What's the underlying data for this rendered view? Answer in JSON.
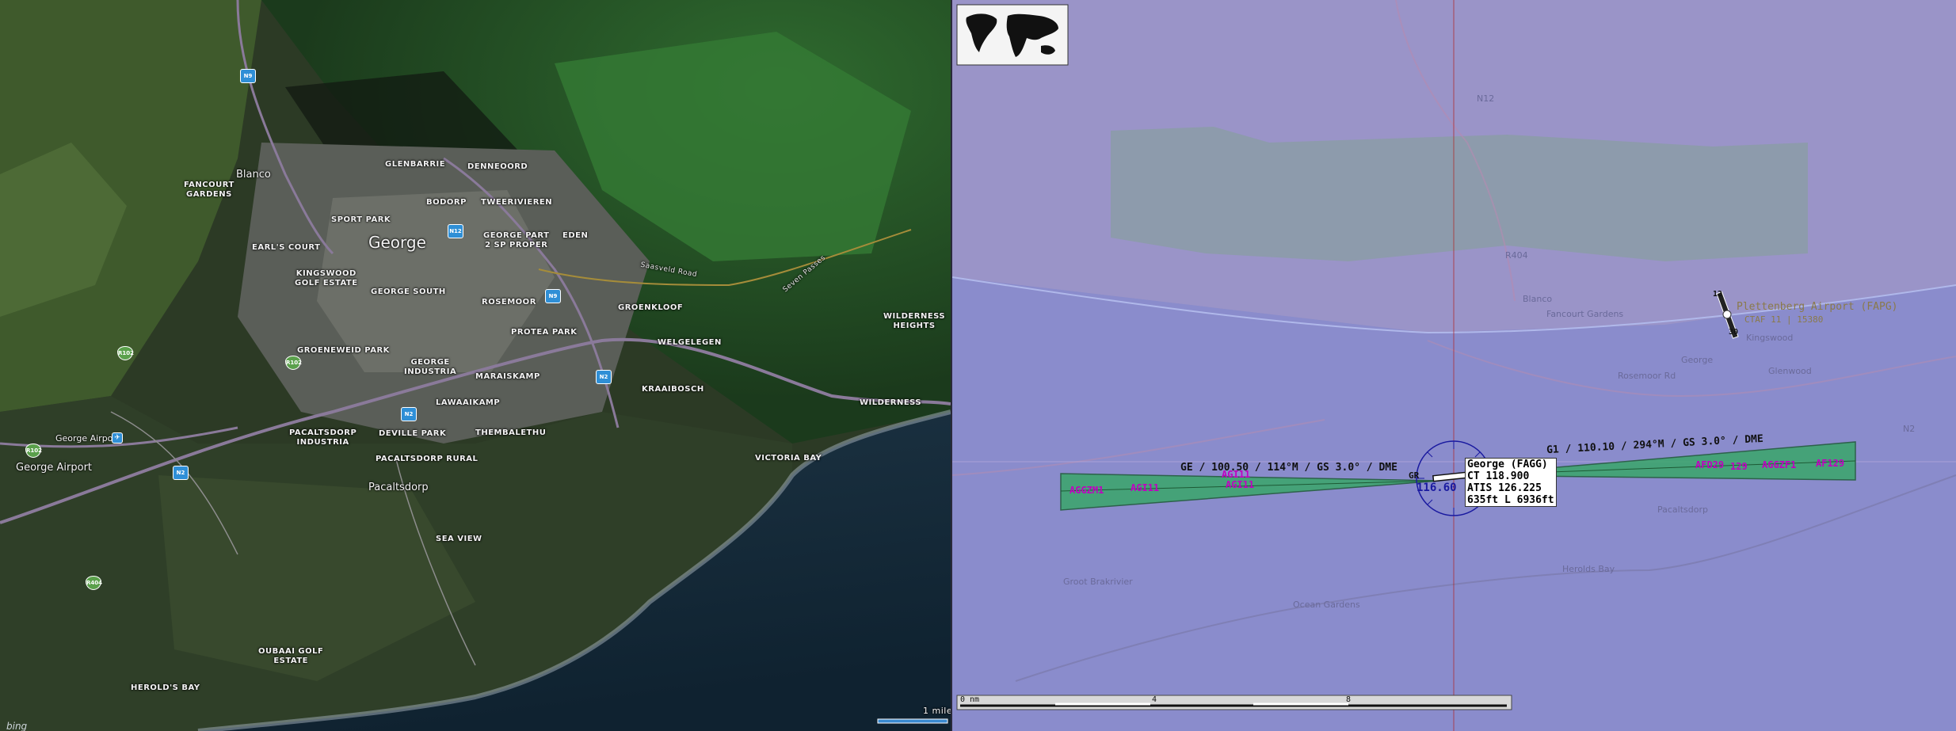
{
  "satellite_map": {
    "provider": "bing",
    "scale_label": "1 mile",
    "labels": {
      "george": "George",
      "blanco": "Blanco",
      "pacaltsdorp": "Pacaltsdorp",
      "george_airport_area": "George Airport",
      "george_airport_marker": "George Airport",
      "glenbarrie": "GLENBARRIE",
      "denneoord": "DENNEOORD",
      "fancourt_gardens": "FANCOURT\nGARDENS",
      "bodorp": "BODORP",
      "tweerivieren": "TWEERIVIEREN",
      "sport_park": "SPORT PARK",
      "george_part": "GEORGE PART\n2 SP PROPER",
      "eden": "EDEN",
      "earls_court": "EARL'S COURT",
      "kingswood": "KINGSWOOD\nGOLF ESTATE",
      "george_south": "GEORGE SOUTH",
      "rosemoor": "ROSEMOOR",
      "groenkloof": "GROENKLOOF",
      "protea_park": "PROTEA PARK",
      "welgelegen": "WELGELEGEN",
      "wilderness_heights": "WILDERNESS\nHEIGHTS",
      "groeneweid_park": "GROENEWEID PARK",
      "george_industria": "GEORGE\nINDUSTRIA",
      "maraiskamp": "MARAISKAMP",
      "kraaibosch": "KRAAIBOSCH",
      "wilderness": "WILDERNESS",
      "lawaaikamp": "LAWAAIKAMP",
      "pacaltsdorp_industria": "PACALTSDORP\nINDUSTRIA",
      "deville_park": "DEVILLE PARK",
      "thembalethu": "THEMBALETHU",
      "victoria_bay": "VICTORIA BAY",
      "pacaltsdorp_rural": "PACALTSDORP RURAL",
      "sea_view": "SEA VIEW",
      "oubaai": "OUBAAI GOLF\nESTATE",
      "herolds_bay": "HEROLD'S BAY",
      "saasveld_road": "Saasveld Road",
      "seven_passes": "Seven Passes"
    },
    "shields": {
      "n9_a": "N9",
      "n12_a": "N12",
      "n9_b": "N9",
      "n2_a": "N2",
      "n2_b": "N2",
      "n2_c": "N2",
      "r102_a": "R102",
      "r102_b": "R102",
      "r404": "R404",
      "r102_c": "R102"
    }
  },
  "nav_map": {
    "ils_left_label": "GE / 100.50 / 114°M / GS 3.0° / DME",
    "ils_right_label": "G1 / 110.10 / 294°M / GS 3.0° / DME",
    "fixes": {
      "fix_a": "AGGZM1",
      "fix_b": "AGI11",
      "fix_c": "AGI11",
      "fix_d": "AGI11",
      "fix_e": "AFD29",
      "fix_f": "AGGZF1",
      "fix_g": "AF129",
      "fix_h": "129"
    },
    "airport_info": {
      "name": "George (FAGG)",
      "ct": "CT 118.900",
      "atis": "ATIS 126.225",
      "elev": "635ft L 6936ft"
    },
    "vor_freq": "116.60",
    "vor_ident": "GR",
    "second_airport_label": "Plettenberg Airport (FAPG)",
    "second_airport_info": "CTAF 11 | 15380",
    "second_runway_ends": {
      "a": "12",
      "b": "30"
    },
    "scale": {
      "start": "0 nm",
      "mid": "4",
      "end": "8"
    },
    "background_labels": {
      "fancourt_gardens": "Fancourt Gardens",
      "george": "George",
      "pacaltsdorp": "Pacaltsdorp",
      "blanco": "Blanco",
      "rosemoor": "Rosemoor Rd",
      "herolds_bay": "Herolds Bay",
      "ocean_gardens": "Ocean Gardens",
      "glenwood": "Glenwood",
      "kingswood": "Kingswood",
      "groot_brakrivier": "Groot Brakrivier"
    },
    "road_labels": {
      "n12": "N12",
      "r404": "R404",
      "n2": "N2"
    }
  },
  "colors": {
    "nav_background": "#8e8ec6",
    "ils_cone_fill": "#3aa76a",
    "fix_magenta": "#c000c0",
    "terrain_green": "#7fa38a",
    "vor_blue": "#1a1aa0",
    "gridline_red": "#b02020"
  }
}
